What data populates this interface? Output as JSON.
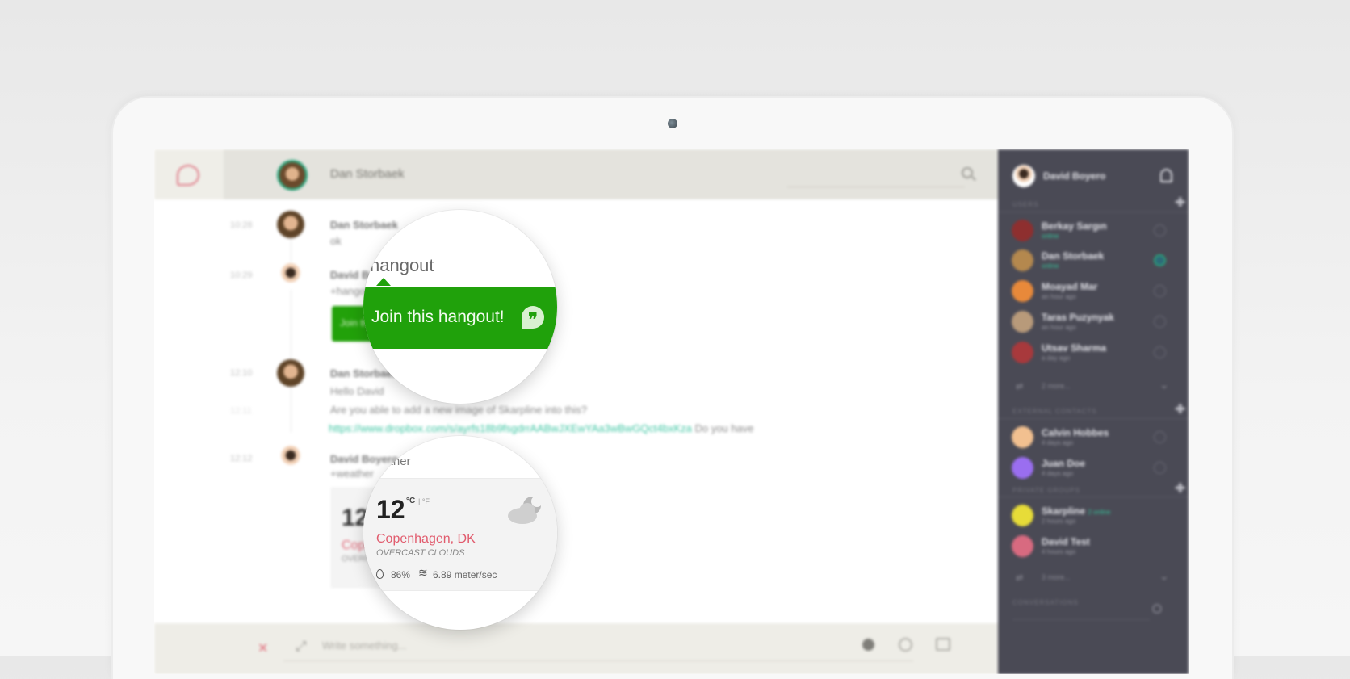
{
  "header": {
    "contact_name": "Dan Storbaek"
  },
  "messages": [
    {
      "time": "10:28",
      "author": "Dan Storbaek",
      "lines": [
        "ok"
      ]
    },
    {
      "time": "10:29",
      "author": "David Boyero",
      "lines": [
        "+hangout"
      ],
      "button": "Join this hangout!"
    },
    {
      "time": "12:10",
      "author": "Dan Storbaek",
      "lines": [
        "Hello David",
        "Are you able to add a new image of Skarpline into this?"
      ],
      "link": "https://www.dropbox.com/s/ayrfs18b9fsgdrrAABwJXEwYAa3wBwGQct4bxKza",
      "link_tail": "Do you have",
      "sub_time": "12:11"
    },
    {
      "time": "12:12",
      "author": "David Boyero",
      "lines": [
        "+weather"
      ]
    }
  ],
  "hangout_zoom": {
    "keyword": "hangout",
    "button": "Join this hangout!"
  },
  "weather": {
    "keyword": "eather",
    "temp": "12",
    "unit_c": "°C",
    "unit_f": "| °F",
    "city": "Copenhagen, DK",
    "condition": "OVERCAST CLOUDS",
    "humidity": "86%",
    "wind": "6.89 meter/sec"
  },
  "composer": {
    "placeholder": "Write something..."
  },
  "sidebar": {
    "me": "David Boyero",
    "sections": {
      "users": "USERS",
      "external": "EXTERNAL CONTACTS",
      "groups": "PRIVATE GROUPS",
      "conversations": "CONVERSATIONS"
    },
    "users": [
      {
        "name": "Berkay Sargın",
        "status": "online",
        "online": true,
        "color": "#8e2f2f"
      },
      {
        "name": "Dan Storbaek",
        "status": "online",
        "online": true,
        "color": "#b4884e"
      },
      {
        "name": "Moayad Mar",
        "status": "an hour ago",
        "online": false,
        "color": "#e8893a"
      },
      {
        "name": "Taras Puzynyak",
        "status": "an hour ago",
        "online": false,
        "color": "#b89a7a"
      },
      {
        "name": "Utsav Sharma",
        "status": "a day ago",
        "online": false,
        "color": "#a8393c"
      }
    ],
    "users_more": "2 more...",
    "external": [
      {
        "name": "Calvin Hobbes",
        "status": "4 days ago",
        "color": "#f2c090"
      },
      {
        "name": "Juan Doe",
        "status": "4 days ago",
        "color": "#9a6ef0"
      }
    ],
    "groups": [
      {
        "name": "Skarpline",
        "badge": "2 online",
        "status": "2 hours ago",
        "color": "#e7dc38"
      },
      {
        "name": "David Test",
        "status": "4 hours ago",
        "color": "#d86a80"
      }
    ],
    "groups_more": "3 more..."
  },
  "colors": {
    "accent_green": "#20a10b",
    "accent_red": "#e15b6d",
    "sidebar_bg": "#4a4a55"
  }
}
